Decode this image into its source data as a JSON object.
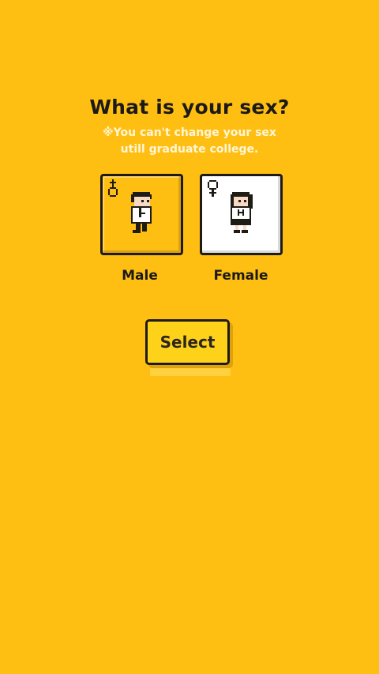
{
  "title": "What is your sex?",
  "note": {
    "line1": "※You can't change your sex",
    "line2": "utill graduate college."
  },
  "options": [
    {
      "label": "Male",
      "symbol": "male-symbol-icon",
      "selected": true
    },
    {
      "label": "Female",
      "symbol": "female-symbol-icon",
      "selected": false
    }
  ],
  "select_button": {
    "label": "Select"
  },
  "colors": {
    "background": "#FFBF12",
    "card_selected": "#FFBF12",
    "card_unselected": "#FFFFFF",
    "button": "#FFD21A",
    "text": "#1c1a18"
  }
}
